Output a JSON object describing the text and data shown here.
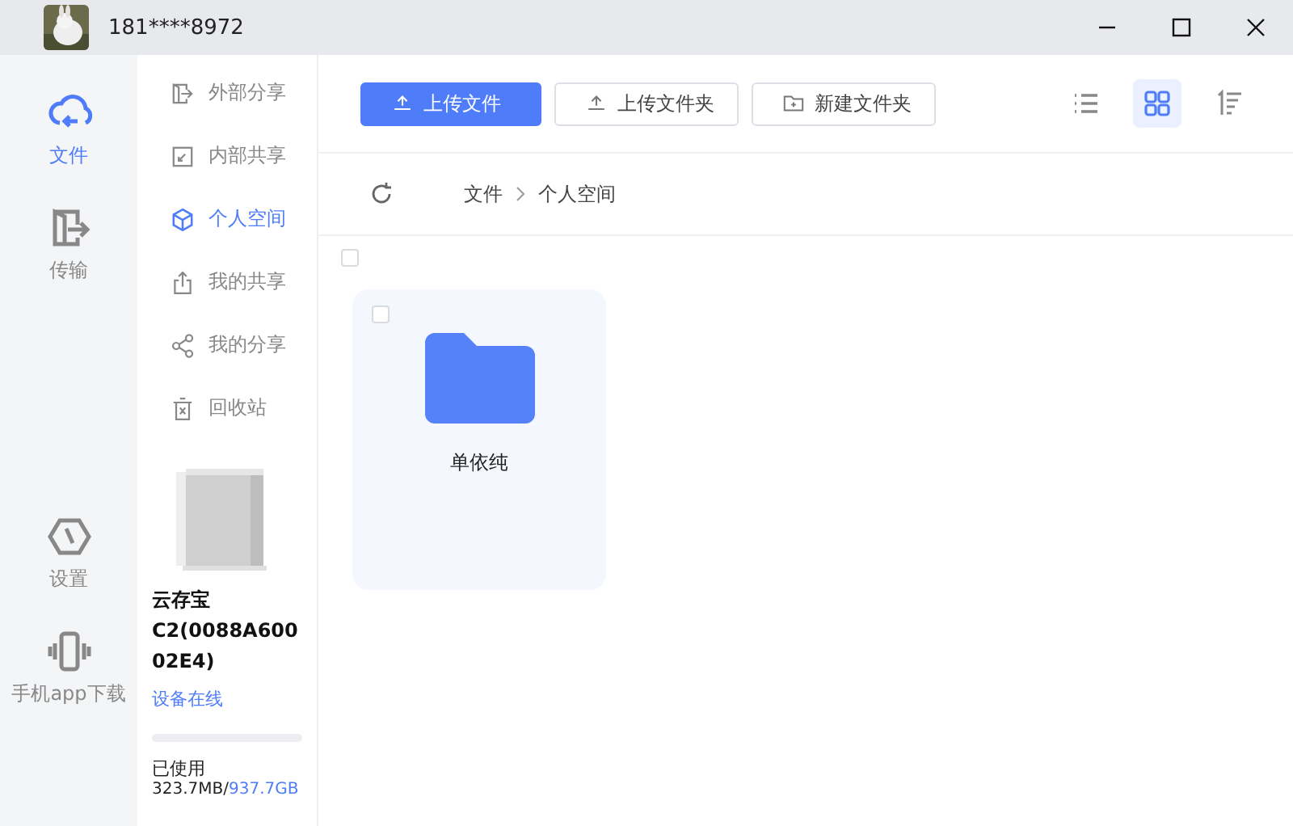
{
  "window": {
    "user": "181****8972"
  },
  "rail": [
    {
      "label": "文件",
      "kind": "cloud",
      "selected": true
    },
    {
      "label": "传输",
      "kind": "transfer",
      "selected": false
    },
    {
      "label": "设置",
      "kind": "hex",
      "selected": false
    },
    {
      "label": "手机app下载",
      "kind": "phone",
      "selected": false
    }
  ],
  "subnav": [
    {
      "label": "外部分享",
      "kind": "out",
      "selected": false
    },
    {
      "label": "内部共享",
      "kind": "in",
      "selected": false
    },
    {
      "label": "个人空间",
      "kind": "cube",
      "selected": true
    },
    {
      "label": "我的共享",
      "kind": "share",
      "selected": false
    },
    {
      "label": "我的分享",
      "kind": "nodes",
      "selected": false
    },
    {
      "label": "回收站",
      "kind": "trash",
      "selected": false
    }
  ],
  "device": {
    "name": "云存宝 C2(0088A60002E4)",
    "status": "设备在线",
    "level": 0.0003,
    "used_label": "已使用",
    "used": "323.7MB/",
    "total": "937.7GB"
  },
  "toolbar": [
    {
      "label": "上传文件",
      "kind": "upload_primary"
    },
    {
      "label": "上传文件夹",
      "kind": "upload"
    },
    {
      "label": "新建文件夹",
      "kind": "folder"
    }
  ],
  "views": [
    {
      "kind": "list",
      "selected": false
    },
    {
      "kind": "grid",
      "selected": true
    },
    {
      "kind": "sort",
      "selected": false
    }
  ],
  "breadcrumb": [
    "文件",
    "个人空间"
  ],
  "select_all": {
    "checked": false
  },
  "items": [
    {
      "name": "单依纯",
      "checked": false
    }
  ]
}
